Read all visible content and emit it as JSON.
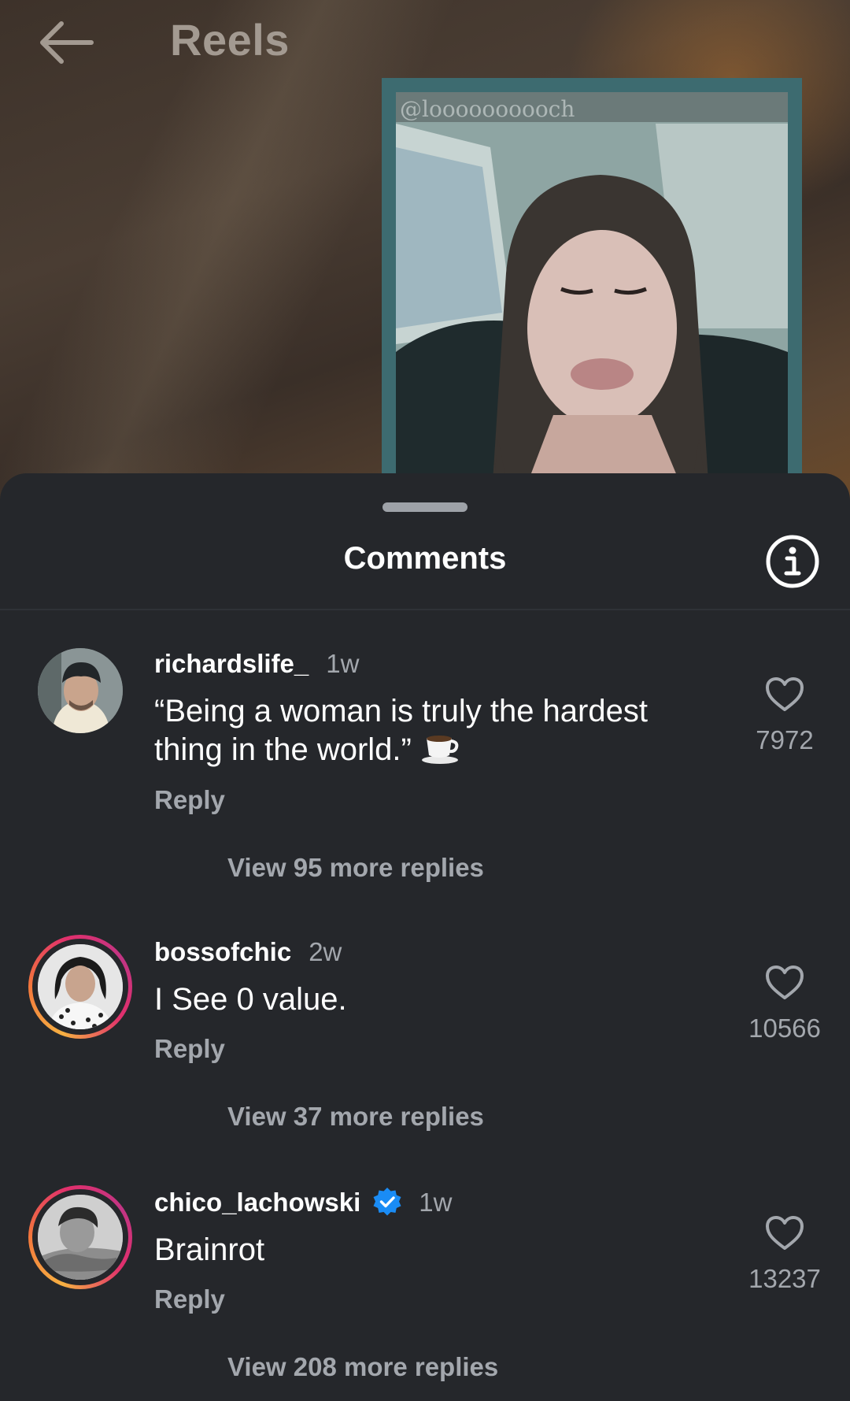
{
  "header": {
    "title": "Reels",
    "back_icon": "arrow-left-icon"
  },
  "reel": {
    "watermark": "@loooooooooch"
  },
  "sheet": {
    "title": "Comments",
    "info_icon": "info-icon"
  },
  "comments": [
    {
      "username": "richardslife_",
      "time": "1w",
      "text": "“Being a woman is truly the hardest thing in the world.”",
      "emoji": "coffee-cup-icon",
      "verified": false,
      "story_ring": false,
      "likes": "7972",
      "reply_label": "Reply",
      "view_replies": "View 95 more replies"
    },
    {
      "username": "bossofchic",
      "time": "2w",
      "text": "I See 0 value.",
      "verified": false,
      "story_ring": true,
      "likes": "10566",
      "reply_label": "Reply",
      "view_replies": "View 37 more replies"
    },
    {
      "username": "chico_lachowski",
      "time": "1w",
      "text": "Brainrot",
      "verified": true,
      "story_ring": true,
      "likes": "13237",
      "reply_label": "Reply",
      "view_replies": "View 208 more replies"
    }
  ],
  "colors": {
    "sheet_background": "#25272b",
    "secondary_text": "#a3a7ad",
    "verified_blue": "#1a8cf5",
    "video_frame": "#3d6b70"
  }
}
